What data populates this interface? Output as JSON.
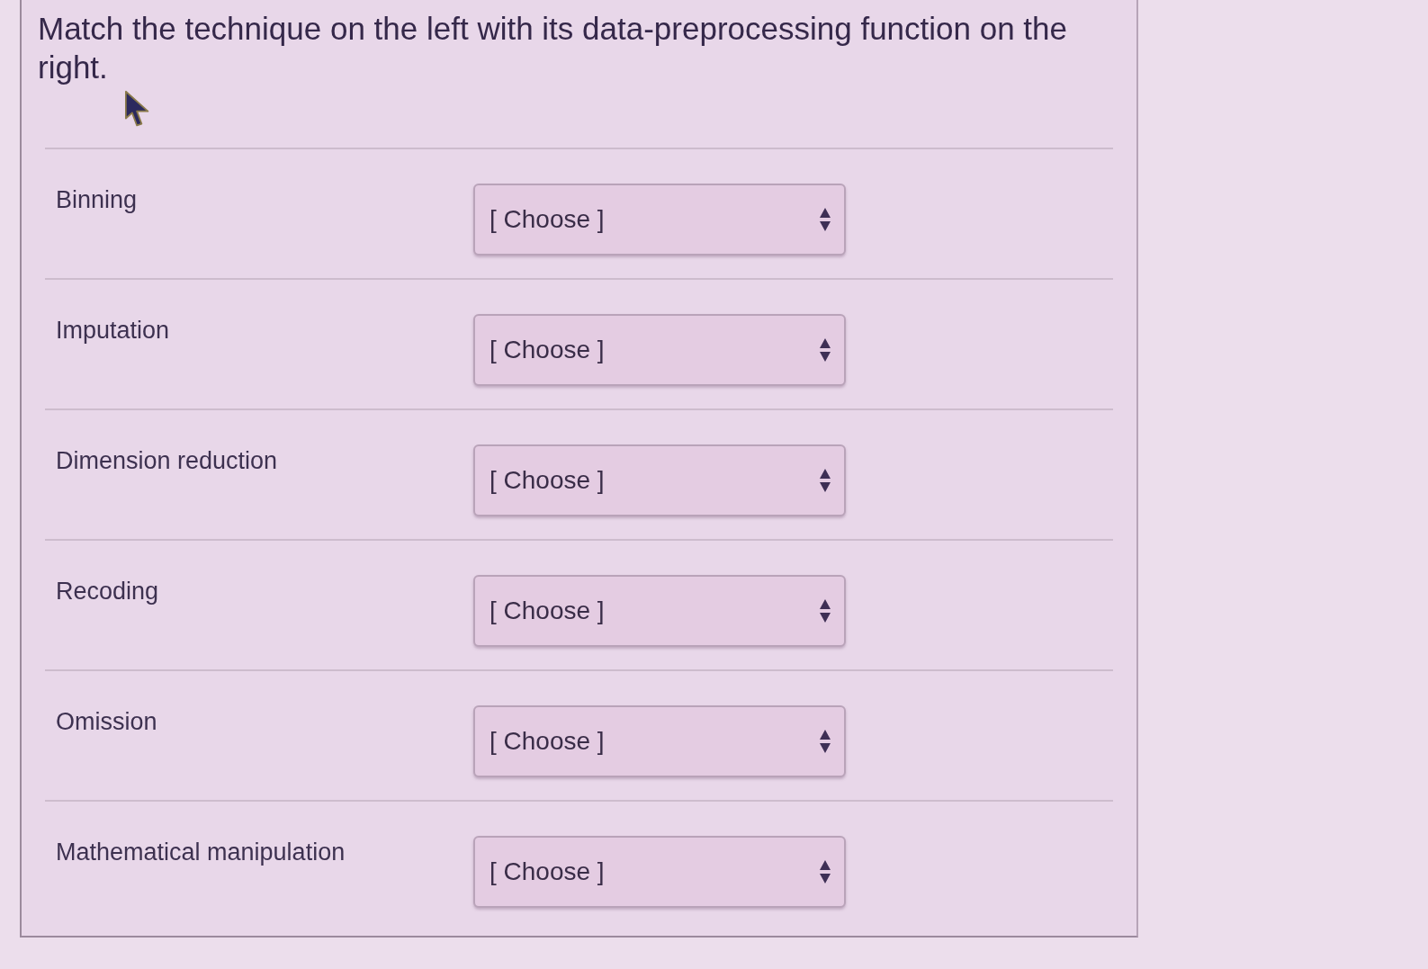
{
  "question": {
    "prompt": "Match the technique on the left with its data-preprocessing function on the right."
  },
  "pairs": [
    {
      "technique": "Binning",
      "dropdown": {
        "value": "[ Choose ]"
      }
    },
    {
      "technique": "Imputation",
      "dropdown": {
        "value": "[ Choose ]"
      }
    },
    {
      "technique": "Dimension reduction",
      "dropdown": {
        "value": "[ Choose ]"
      }
    },
    {
      "technique": "Recoding",
      "dropdown": {
        "value": "[ Choose ]"
      }
    },
    {
      "technique": "Omission",
      "dropdown": {
        "value": "[ Choose ]"
      }
    },
    {
      "technique": "Mathematical manipulation",
      "dropdown": {
        "value": "[ Choose ]"
      }
    }
  ]
}
